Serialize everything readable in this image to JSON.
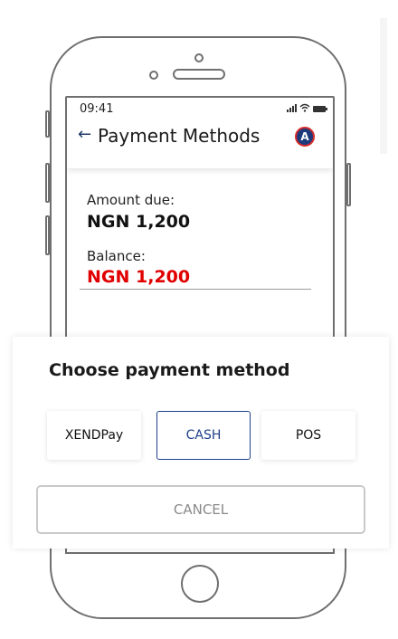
{
  "status_bar": {
    "time": "09:41"
  },
  "header": {
    "back_icon": "←",
    "title": "Payment Methods",
    "avatar_letter": "A"
  },
  "summary": {
    "amount_due_label": "Amount due:",
    "amount_due_value": "NGN 1,200",
    "balance_label": "Balance:",
    "balance_value": "NGN 1,200",
    "balance_color": "#e00000"
  },
  "sheet": {
    "title": "Choose payment method",
    "methods": [
      {
        "label": "XENDPay",
        "selected": false
      },
      {
        "label": "CASH",
        "selected": true
      },
      {
        "label": "POS",
        "selected": false
      }
    ],
    "cancel_label": "CANCEL"
  },
  "colors": {
    "accent": "#1e3f8a",
    "avatar_border": "#d52b2b"
  },
  "icons": {
    "back": "back-arrow-icon",
    "signal": "signal-icon",
    "wifi": "wifi-icon",
    "battery": "battery-icon",
    "avatar": "avatar-icon"
  }
}
